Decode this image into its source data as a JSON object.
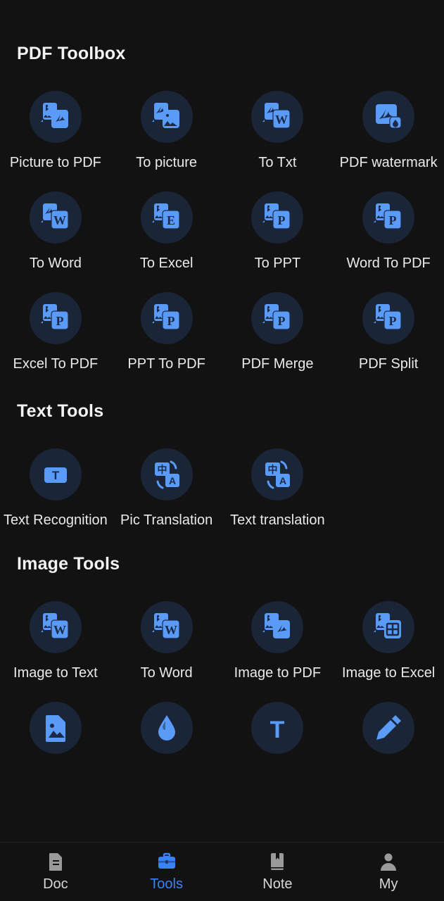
{
  "theme": {
    "background": "#121212",
    "circle_background": "#1b2538",
    "icon_blue": "#5b9bf8",
    "icon_blue_dark": "#1b2a47",
    "accent": "#3b82f6",
    "text": "#eaeaea",
    "nav_inactive": "#9a9a9a"
  },
  "sections": [
    {
      "title": "PDF Toolbox",
      "name": "pdf-toolbox",
      "items": [
        {
          "label": "Picture to PDF",
          "icon": "picture-to-pdf-icon",
          "glyph": "img-to-pdf"
        },
        {
          "label": "To picture",
          "icon": "to-picture-icon",
          "glyph": "pdf-to-img"
        },
        {
          "label": "To Txt",
          "icon": "to-txt-icon",
          "glyph": "pdf-to-w"
        },
        {
          "label": "PDF watermark",
          "icon": "pdf-watermark-icon",
          "glyph": "pdf-watermark"
        },
        {
          "label": "To Word",
          "icon": "to-word-icon",
          "glyph": "pdf-to-w"
        },
        {
          "label": "To Excel",
          "icon": "to-excel-icon",
          "glyph": "img-to-e"
        },
        {
          "label": "To PPT",
          "icon": "to-ppt-icon",
          "glyph": "img-to-p"
        },
        {
          "label": "Word To PDF",
          "icon": "word-to-pdf-icon",
          "glyph": "img-to-p"
        },
        {
          "label": "Excel To PDF",
          "icon": "excel-to-pdf-icon",
          "glyph": "img-to-p"
        },
        {
          "label": "PPT To PDF",
          "icon": "ppt-to-pdf-icon",
          "glyph": "img-to-p"
        },
        {
          "label": "PDF Merge",
          "icon": "pdf-merge-icon",
          "glyph": "img-to-p"
        },
        {
          "label": "PDF Split",
          "icon": "pdf-split-icon",
          "glyph": "img-to-p"
        }
      ]
    },
    {
      "title": "Text Tools",
      "name": "text-tools",
      "items": [
        {
          "label": "Text Recognition",
          "icon": "text-recognition-icon",
          "glyph": "text-t",
          "wrap": true
        },
        {
          "label": "Pic Translation",
          "icon": "pic-translation-icon",
          "glyph": "translate"
        },
        {
          "label": "Text translation",
          "icon": "text-translation-icon",
          "glyph": "translate"
        }
      ]
    },
    {
      "title": "Image Tools",
      "name": "image-tools",
      "items": [
        {
          "label": "Image to Text",
          "icon": "image-to-text-icon",
          "glyph": "img-to-w"
        },
        {
          "label": "To Word",
          "icon": "image-to-word-icon",
          "glyph": "img-to-w"
        },
        {
          "label": "Image to PDF",
          "icon": "image-to-pdf-icon",
          "glyph": "img-to-pdf2"
        },
        {
          "label": "Image to Excel",
          "icon": "image-to-excel-icon",
          "glyph": "img-to-grid"
        },
        {
          "label": "",
          "icon": "image-compress-icon",
          "glyph": "image-file"
        },
        {
          "label": "",
          "icon": "add-watermark-icon",
          "glyph": "water-drop"
        },
        {
          "label": "",
          "icon": "add-text-icon",
          "glyph": "text-t-plain"
        },
        {
          "label": "",
          "icon": "image-edit-icon",
          "glyph": "pencil"
        }
      ]
    }
  ],
  "bottom_nav": {
    "items": [
      {
        "label": "Doc",
        "icon": "document-icon",
        "active": false
      },
      {
        "label": "Tools",
        "icon": "toolbox-icon",
        "active": true
      },
      {
        "label": "Note",
        "icon": "notebook-icon",
        "active": false
      },
      {
        "label": "My",
        "icon": "person-icon",
        "active": false
      }
    ]
  }
}
